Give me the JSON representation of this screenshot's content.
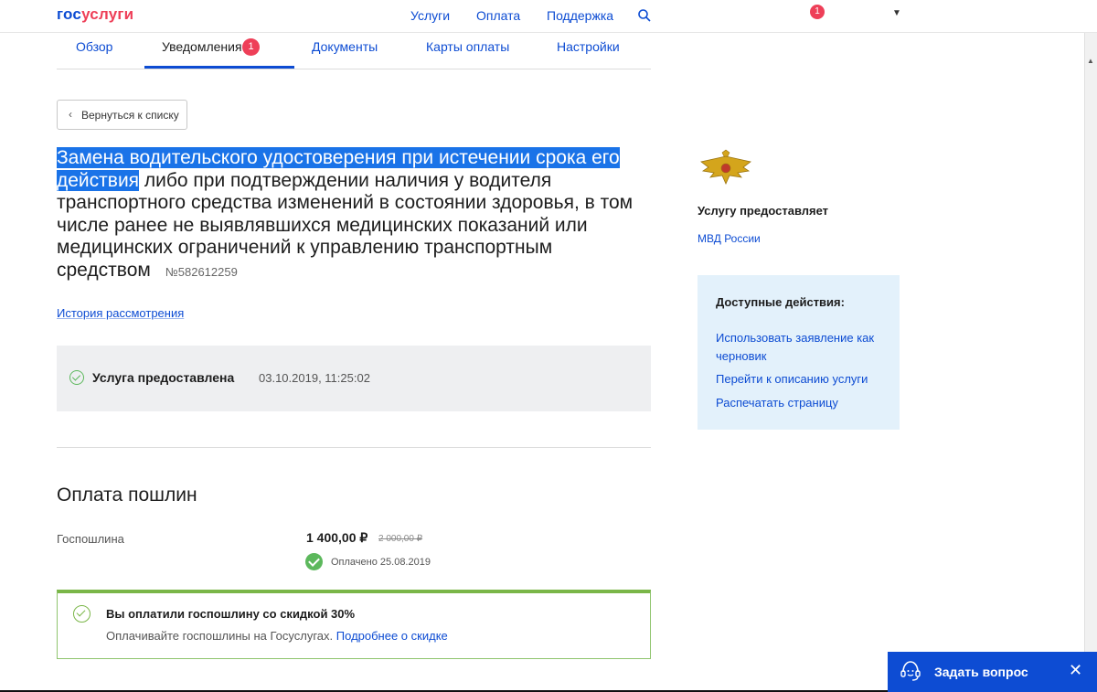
{
  "header": {
    "logo_part1": "гос",
    "logo_part2": "услуги",
    "nav": [
      "Услуги",
      "Оплата",
      "Поддержка"
    ],
    "notifications_count": "1"
  },
  "tabs": [
    {
      "label": "Обзор"
    },
    {
      "label": "Уведомления",
      "badge": "1",
      "active": true
    },
    {
      "label": "Документы"
    },
    {
      "label": "Карты оплаты"
    },
    {
      "label": "Настройки"
    }
  ],
  "back_button": "Вернуться к списку",
  "application": {
    "title_highlighted": "Замена водительского удостоверения при истечении срока его действия",
    "title_rest": " либо при подтверждении наличия у водителя транспортного средства изменений в состоянии здоровья, в том числе ранее не выявлявшихся медицинских показаний или медицинских ограничений к управлению транспортным средством",
    "number": "№582612259"
  },
  "history_link": "История рассмотрения",
  "status": {
    "label": "Услуга предоставлена",
    "datetime": "03.10.2019, 11:25:02"
  },
  "payment": {
    "heading": "Оплата пошлин",
    "fee_label": "Госпошлина",
    "amount": "1 400,00 ₽",
    "old_amount": "2 000,00 ₽",
    "paid_text": "Оплачено 25.08.2019"
  },
  "discount": {
    "title": "Вы оплатили госпошлину со скидкой 30%",
    "text": "Оплачивайте госпошлины на Госуслугах.",
    "link": "Подробнее о скидке"
  },
  "provider": {
    "label": "Услугу предоставляет",
    "name": "МВД России"
  },
  "actions": {
    "title": "Доступные действия:",
    "items": [
      "Использовать заявление как черновик",
      "Перейти к описанию услуги",
      "Распечатать страницу"
    ]
  },
  "ask_widget": {
    "label": "Задать вопрос"
  },
  "colors": {
    "brand_blue": "#0d4cd3",
    "brand_red": "#ee3f58",
    "success_green": "#5cb85c",
    "highlight": "#1a73e8"
  }
}
